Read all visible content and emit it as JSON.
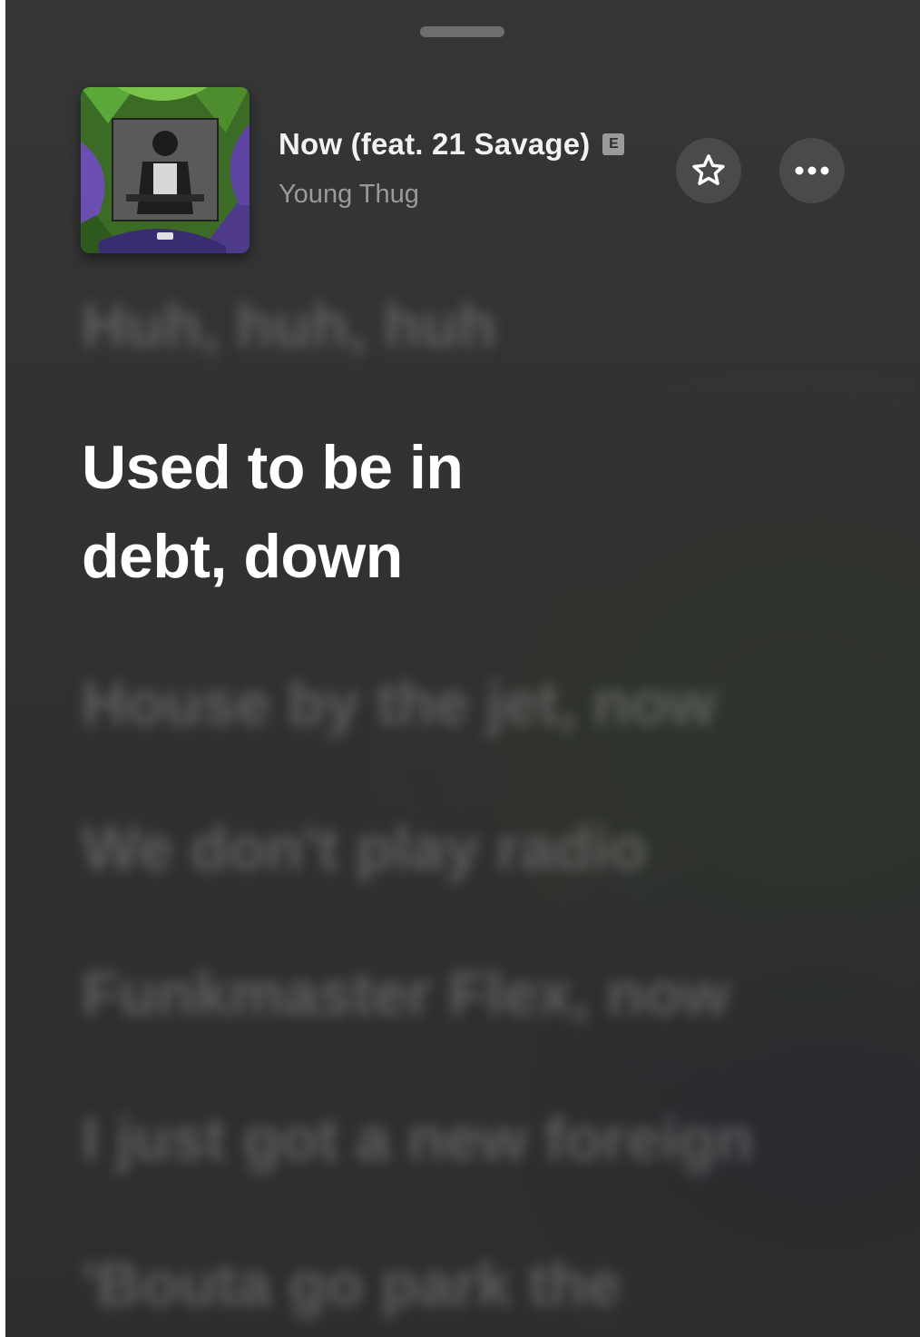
{
  "now_playing": {
    "title": "Now (feat. 21 Savage)",
    "explicit_badge": "E",
    "artist": "Young Thug",
    "artwork_icon": "album-artwork"
  },
  "controls": {
    "favorite_icon": "star-icon",
    "more_icon": "ellipsis-icon"
  },
  "lyrics": {
    "previous": "Huh, huh, huh",
    "current": "Used to be in debt, down",
    "upcoming": [
      "House by the jet, now",
      "We don't play radio",
      "Funkmaster Flex, now",
      "I just got a new foreign",
      "'Bouta go park the"
    ]
  }
}
